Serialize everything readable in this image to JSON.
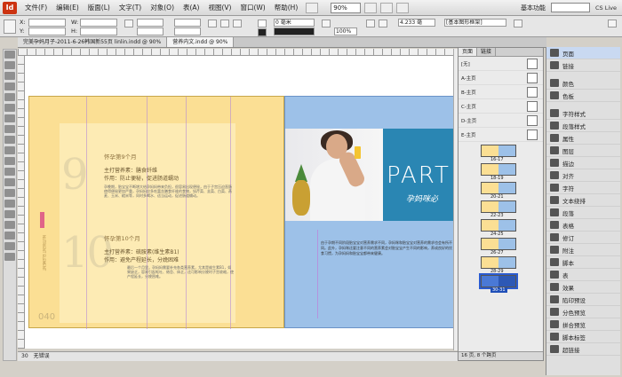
{
  "menubar": {
    "logo": "Id",
    "items": [
      "文件(F)",
      "编辑(E)",
      "版面(L)",
      "文字(T)",
      "对象(O)",
      "表(A)",
      "视图(V)",
      "窗口(W)",
      "帮助(H)"
    ],
    "zoom": "90%",
    "workspace": "基本功能",
    "cs_live": "CS Live"
  },
  "controlbar": {
    "x_label": "X:",
    "y_label": "Y:",
    "w_label": "W:",
    "h_label": "H:",
    "stroke_weight": "0 毫米",
    "percent": "100%",
    "value_4233": "4.233 毫",
    "frame_style": "[基本图形框架]"
  },
  "tabs": [
    {
      "label": "完美孕妈月子-2011-6-26韩国新55页 linlin.indd @ 90%",
      "active": false
    },
    {
      "label": "营养内文.indd @ 90%",
      "active": true
    }
  ],
  "left_page": {
    "heading_9": "怀孕第9个月",
    "sub_9a": "主打营养素：膳食纤维",
    "sub_9b": "作用：防止便秘，促进肠道蠕动",
    "heading_10": "怀孕第10个月",
    "sub_10a": "主打营养素：硫胺素(维生素B1)",
    "sub_10b": "作用：避免产程延长，分娩困难",
    "body_9": "孕晚期，胎宝宝不断增大给孕妈妈带来负担，很容易出现便秘，由于子宫压迫直肠使得便秘更加严重，孕妈妈应多吃富含膳食纤维的食物，如芹菜、韭菜、白菜、燕麦、玉米、糙米等，同时多喝水、适当运动，促进肠道蠕动。",
    "body_10": "最后一个月里，孕妈妈需要补充各类营养素，尤其是维生素B1，如果缺乏，容易引起呕吐、倦怠、体乏，还可影响分娩时子宫收缩，使产程延长，分娩困难。",
    "big_9": "9",
    "big_10": "10",
    "page_number": "040",
    "vertical_label": "NUTRIENT ELEMENT"
  },
  "right_page": {
    "part_title": "PART",
    "part_subtitle": "孕妈咪必",
    "body": "由于孕期不同阶段胎宝宝对营养需求不同，孕妈咪和胎宝宝对营养的需求也会有所不同。此外，孕妈咪还要注意不同的营养素会对胎宝宝产生不同的影响，养成良好的饮食习惯，为孕妈妈和胎宝宝都带来健康。"
  },
  "pages_panel": {
    "tabs": [
      "页面",
      "链接"
    ],
    "masters": [
      "[无]",
      "A-主页",
      "B-主页",
      "C-主页",
      "D-主页",
      "E-主页"
    ],
    "spreads": [
      "16-17",
      "18-19",
      "20-21",
      "22-23",
      "24-25",
      "26-27",
      "28-29",
      "30-31"
    ],
    "selected": "30-31",
    "status": "16 页, 8 个跨页"
  },
  "dock": {
    "items": [
      "页面",
      "链接",
      "颜色",
      "色板",
      "字符样式",
      "段落样式",
      "属性",
      "图层",
      "描边",
      "对齐",
      "字符",
      "文本绕排",
      "段落",
      "表格",
      "修订",
      "附注",
      "脚本",
      "表",
      "效果",
      "陷印预设",
      "分色预览",
      "拼合预览",
      "脚本标签",
      "超链接"
    ]
  },
  "statusbar": {
    "page": "30",
    "state": "无错误"
  }
}
